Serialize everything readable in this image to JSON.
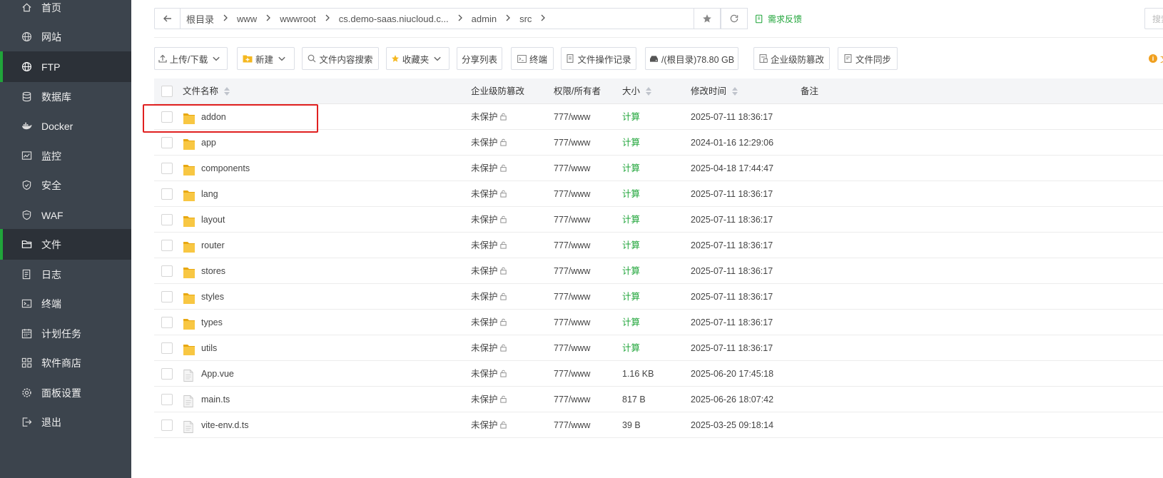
{
  "sidebar": {
    "items": [
      {
        "label": "首页",
        "icon": "home-icon",
        "active": false
      },
      {
        "label": "网站",
        "icon": "globe-icon",
        "active": false
      },
      {
        "label": "FTP",
        "icon": "ftp-globe-icon",
        "active": true
      },
      {
        "label": "数据库",
        "icon": "database-icon",
        "active": false
      },
      {
        "label": "Docker",
        "icon": "docker-icon",
        "active": false
      },
      {
        "label": "监控",
        "icon": "monitor-icon",
        "active": false
      },
      {
        "label": "安全",
        "icon": "shield-icon",
        "active": false
      },
      {
        "label": "WAF",
        "icon": "waf-shield-icon",
        "active": false
      },
      {
        "label": "文件",
        "icon": "folder-icon",
        "active": true
      },
      {
        "label": "日志",
        "icon": "log-icon",
        "active": false
      },
      {
        "label": "终端",
        "icon": "terminal-icon",
        "active": false
      },
      {
        "label": "计划任务",
        "icon": "calendar-icon",
        "active": false
      },
      {
        "label": "软件商店",
        "icon": "apps-icon",
        "active": false
      },
      {
        "label": "面板设置",
        "icon": "gear-icon",
        "active": false
      },
      {
        "label": "退出",
        "icon": "logout-icon",
        "active": false
      }
    ]
  },
  "breadcrumb": {
    "segments": [
      "根目录",
      "www",
      "wwwroot",
      "cs.demo-saas.niucloud.c...",
      "admin",
      "src"
    ]
  },
  "feedback_label": "需求反馈",
  "search_placeholder": "搜索",
  "toolbar": {
    "upload_label": "上传/下载",
    "new_label": "新建",
    "search_content_label": "文件内容搜索",
    "favorites_label": "收藏夹",
    "share_list_label": "分享列表",
    "terminal_label": "终端",
    "file_log_label": "文件操作记录",
    "disk_label": "/(根目录)78.80 GB",
    "tamper_label": "企业级防篡改",
    "sync_label": "文件同步",
    "tip_text": "文"
  },
  "table": {
    "headers": {
      "name": "文件名称",
      "protect": "企业级防篡改",
      "perm": "权限/所有者",
      "size": "大小",
      "mtime": "修改时间",
      "note": "备注"
    },
    "rows": [
      {
        "name": "addon",
        "type": "folder",
        "protect": "未保护",
        "perm": "777/www",
        "size": "计算",
        "mtime": "2025-07-11 18:36:17"
      },
      {
        "name": "app",
        "type": "folder",
        "protect": "未保护",
        "perm": "777/www",
        "size": "计算",
        "mtime": "2024-01-16 12:29:06"
      },
      {
        "name": "components",
        "type": "folder",
        "protect": "未保护",
        "perm": "777/www",
        "size": "计算",
        "mtime": "2025-04-18 17:44:47"
      },
      {
        "name": "lang",
        "type": "folder",
        "protect": "未保护",
        "perm": "777/www",
        "size": "计算",
        "mtime": "2025-07-11 18:36:17"
      },
      {
        "name": "layout",
        "type": "folder",
        "protect": "未保护",
        "perm": "777/www",
        "size": "计算",
        "mtime": "2025-07-11 18:36:17"
      },
      {
        "name": "router",
        "type": "folder",
        "protect": "未保护",
        "perm": "777/www",
        "size": "计算",
        "mtime": "2025-07-11 18:36:17"
      },
      {
        "name": "stores",
        "type": "folder",
        "protect": "未保护",
        "perm": "777/www",
        "size": "计算",
        "mtime": "2025-07-11 18:36:17"
      },
      {
        "name": "styles",
        "type": "folder",
        "protect": "未保护",
        "perm": "777/www",
        "size": "计算",
        "mtime": "2025-07-11 18:36:17"
      },
      {
        "name": "types",
        "type": "folder",
        "protect": "未保护",
        "perm": "777/www",
        "size": "计算",
        "mtime": "2025-07-11 18:36:17"
      },
      {
        "name": "utils",
        "type": "folder",
        "protect": "未保护",
        "perm": "777/www",
        "size": "计算",
        "mtime": "2025-07-11 18:36:17"
      },
      {
        "name": "App.vue",
        "type": "file",
        "protect": "未保护",
        "perm": "777/www",
        "size": "1.16 KB",
        "mtime": "2025-06-20 17:45:18"
      },
      {
        "name": "main.ts",
        "type": "file",
        "protect": "未保护",
        "perm": "777/www",
        "size": "817 B",
        "mtime": "2025-06-26 18:07:42"
      },
      {
        "name": "vite-env.d.ts",
        "type": "file",
        "protect": "未保护",
        "perm": "777/www",
        "size": "39 B",
        "mtime": "2025-03-25 09:18:14"
      }
    ]
  },
  "colors": {
    "sidebar_bg": "#3c444d",
    "sidebar_active_bg": "#2c3138",
    "accent_green": "#20a53a",
    "folder_yellow": "#f5c13b",
    "highlight_red": "#e02020"
  }
}
